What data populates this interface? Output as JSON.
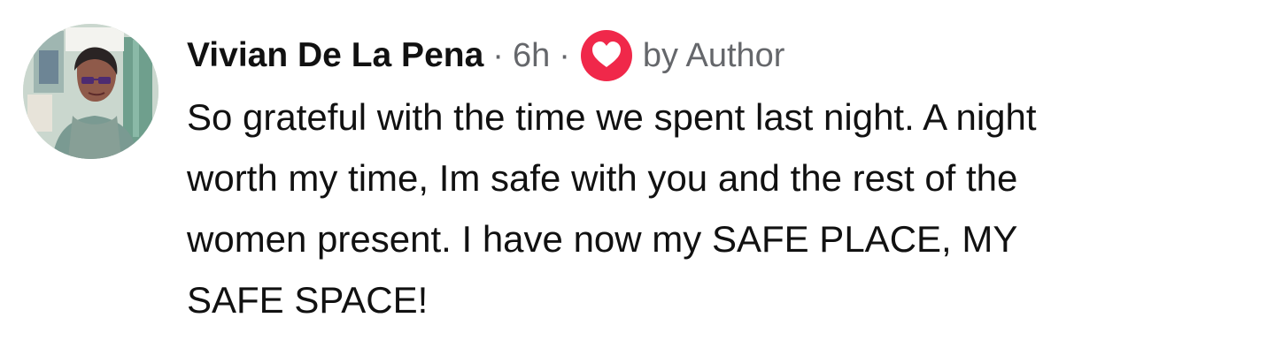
{
  "comment": {
    "author": "Vivian De La Pena",
    "separator": "·",
    "time": "6h",
    "reaction_icon": "heart-icon",
    "reaction_label": "by Author",
    "body_lines": [
      "So grateful with the time we spent last night. A night",
      "worth my time, Im safe with you and the rest of the",
      "women present. I have now my SAFE PLACE, MY",
      "SAFE SPACE!"
    ]
  },
  "colors": {
    "text_primary": "#111111",
    "text_secondary": "#65676b",
    "heart_red": "#f0284a",
    "background": "#ffffff"
  }
}
